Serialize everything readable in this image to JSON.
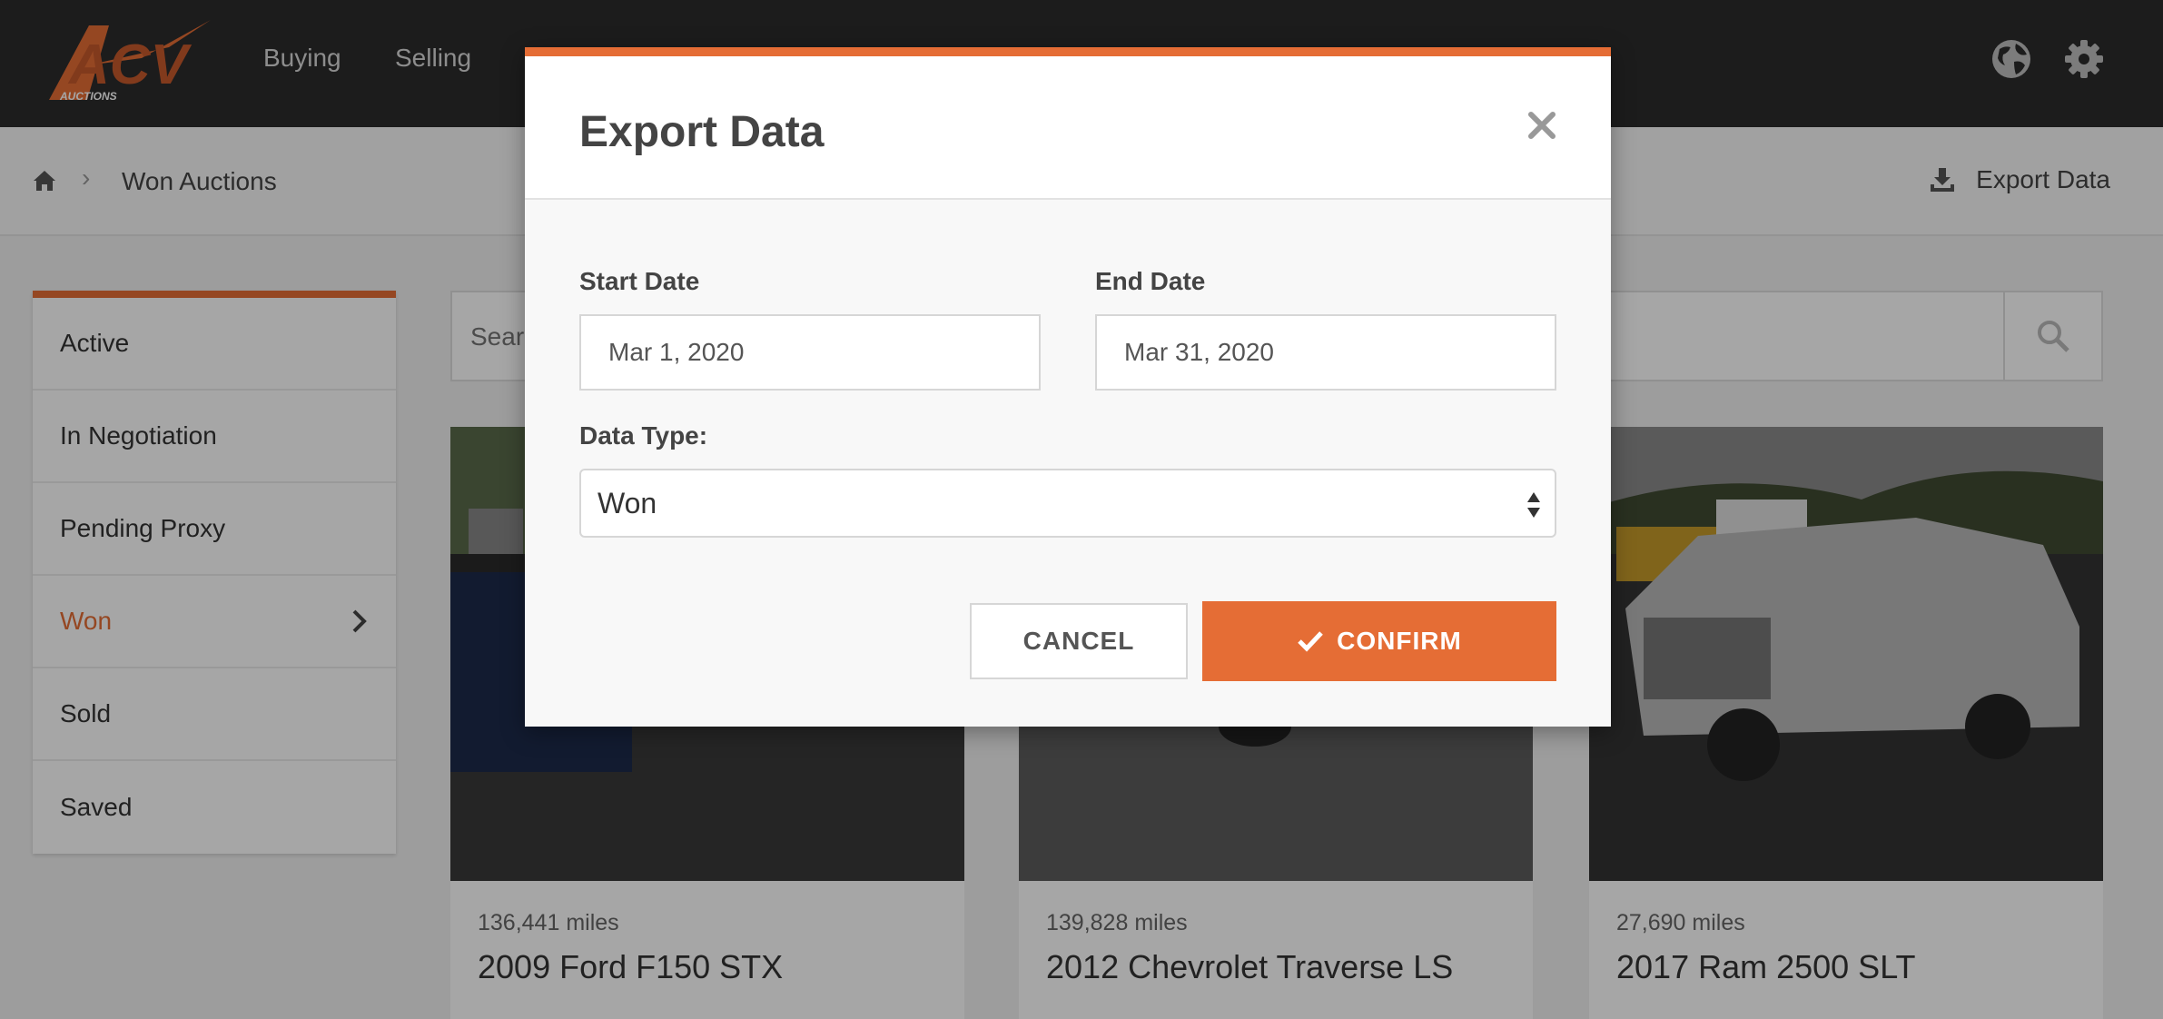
{
  "nav": {
    "logo_text": "ACV",
    "logo_sub": "AUCTIONS",
    "links": [
      "Buying",
      "Selling"
    ]
  },
  "breadcrumb": {
    "current": "Won Auctions",
    "export_label": "Export Data"
  },
  "sidebar": {
    "items": [
      {
        "label": "Active"
      },
      {
        "label": "In Negotiation"
      },
      {
        "label": "Pending Proxy"
      },
      {
        "label": "Won"
      },
      {
        "label": "Sold"
      },
      {
        "label": "Saved"
      }
    ],
    "selected": "Won"
  },
  "search": {
    "placeholder": "Search"
  },
  "cards": [
    {
      "miles": "136,441 miles",
      "title": "2009 Ford F150 STX"
    },
    {
      "miles": "139,828 miles",
      "title": "2012 Chevrolet Traverse LS"
    },
    {
      "miles": "27,690 miles",
      "title": "2017 Ram 2500 SLT"
    }
  ],
  "modal": {
    "title": "Export Data",
    "start_label": "Start Date",
    "start_value": "Mar 1, 2020",
    "end_label": "End Date",
    "end_value": "Mar 31, 2020",
    "type_label": "Data Type:",
    "type_value": "Won",
    "cancel_label": "CANCEL",
    "confirm_label": "CONFIRM"
  },
  "colors": {
    "accent": "#e56d35",
    "topbar": "#2b2b2b"
  },
  "icons": [
    "home-icon",
    "download-icon",
    "globe-icon",
    "gear-icon",
    "search-icon",
    "chevron-right-icon",
    "close-icon",
    "check-icon",
    "select-arrows-icon"
  ]
}
